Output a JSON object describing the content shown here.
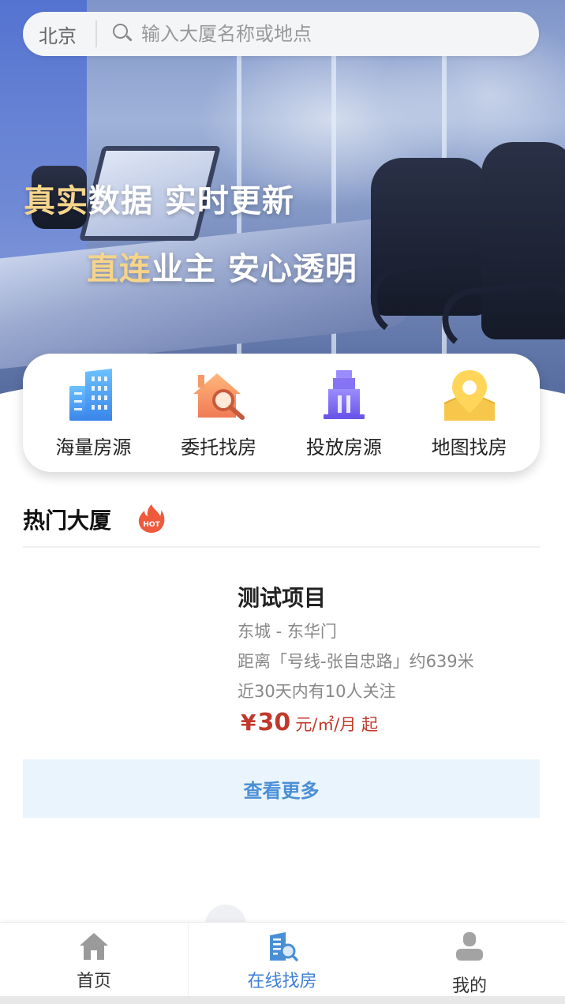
{
  "search": {
    "city": "北京",
    "placeholder": "输入大厦名称或地点"
  },
  "banner": {
    "line1_highlight": "真实",
    "line1_rest": "数据  实时更新",
    "line2_highlight": "直连",
    "line2_rest": "业主  安心透明"
  },
  "quick_menu": [
    {
      "label": "海量房源",
      "icon": "building-icon",
      "color": "#4a9df0"
    },
    {
      "label": "委托找房",
      "icon": "house-search-icon",
      "color": "#f08f5a"
    },
    {
      "label": "投放房源",
      "icon": "tower-icon",
      "color": "#7b6cf0"
    },
    {
      "label": "地图找房",
      "icon": "map-pin-icon",
      "color": "#f6c74a"
    }
  ],
  "hot": {
    "title": "热门大厦",
    "badge": "HOT",
    "items": [
      {
        "name": "测试项目",
        "area": "东城 - 东华门",
        "distance": "距离「号线-张自忠路」约639米",
        "followers": "近30天内有10人关注",
        "currency": "¥",
        "price": "30",
        "unit": "元/㎡/月 起"
      }
    ],
    "more_label": "查看更多"
  },
  "tabbar": {
    "items": [
      {
        "label": "首页",
        "icon": "home-icon"
      },
      {
        "label": "在线找房",
        "icon": "search-building-icon",
        "active": true
      },
      {
        "label": "我的",
        "icon": "user-icon"
      }
    ]
  },
  "colors": {
    "accent": "#3f7fd4",
    "price": "#c0392b",
    "more_bg": "#eaf4fc",
    "highlight": "#f6d48a"
  }
}
